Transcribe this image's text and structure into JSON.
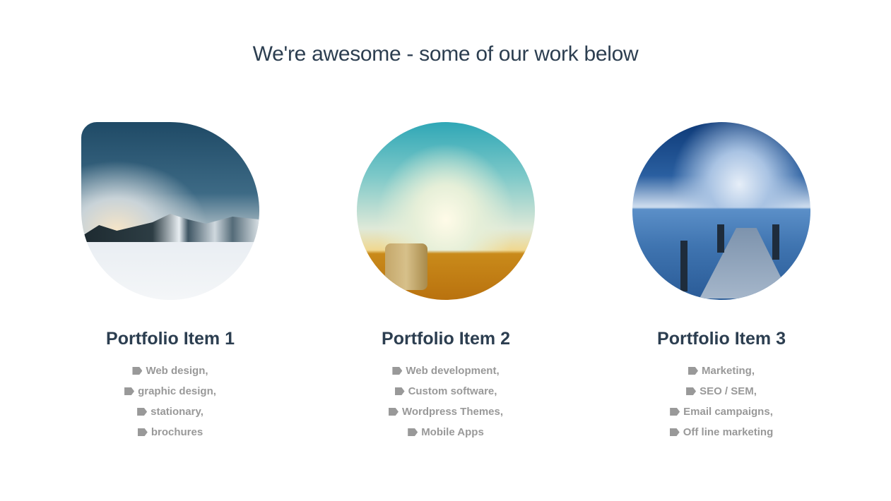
{
  "heading": "We're awesome - some of our work below",
  "items": [
    {
      "title": "Portfolio Item 1",
      "image": "snowy-forest-landscape",
      "tags": [
        "Web design,",
        "graphic design,",
        "stationary,",
        "brochures"
      ]
    },
    {
      "title": "Portfolio Item 2",
      "image": "hay-bales-under-cloudy-sky",
      "tags": [
        "Web development,",
        "Custom software,",
        "Wordpress Themes,",
        "Mobile Apps"
      ]
    },
    {
      "title": "Portfolio Item 3",
      "image": "wooden-pier-on-sea",
      "tags": [
        "Marketing,",
        "SEO / SEM,",
        "Email campaigns,",
        "Off line marketing"
      ]
    }
  ],
  "colors": {
    "heading": "#2c3e50",
    "tag": "#999999"
  }
}
